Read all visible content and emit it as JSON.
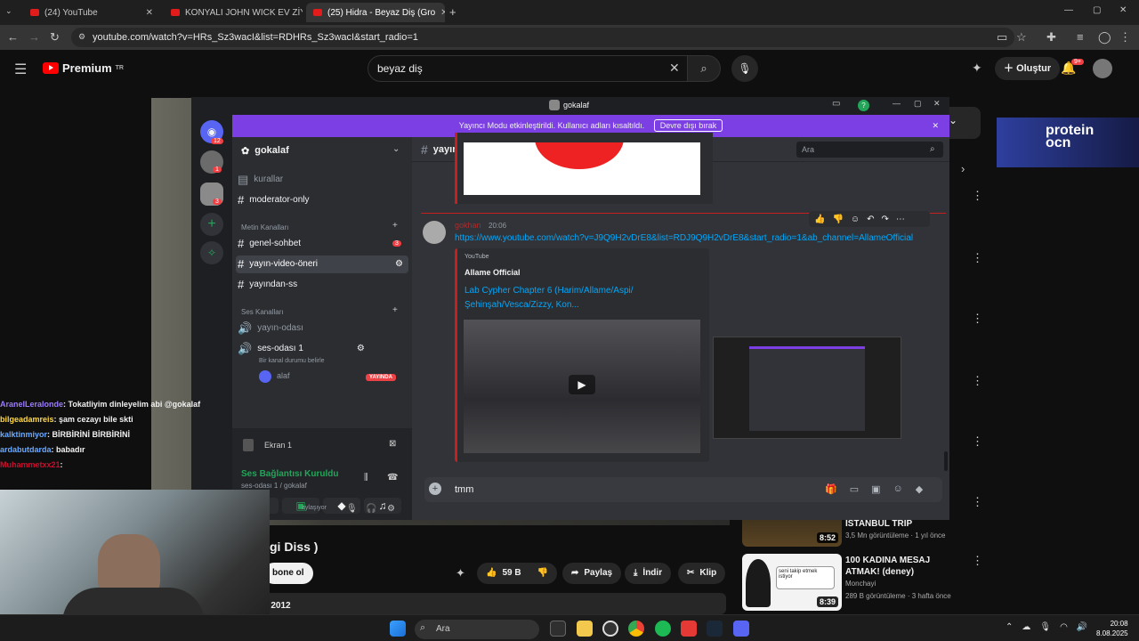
{
  "browser": {
    "tabs": [
      {
        "title": "(24) YouTube"
      },
      {
        "title": "KONYALI JOHN WICK EV ZİYAR"
      },
      {
        "title": "(25) Hidra - Beyaz Diş (Gro"
      }
    ],
    "url": "youtube.com/watch?v=HRs_Sz3wacI&list=RDHRs_Sz3wacI&start_radio=1"
  },
  "youtube": {
    "logo_text": "Premium",
    "logo_sup": "TR",
    "search_value": "beyaz diş",
    "create_label": "Oluştur",
    "notif_badge": "9+",
    "video_title_fragment": "gi Diss )",
    "subscribe_label": "bone ol",
    "like_count": "59 B",
    "share_label": "Paylaş",
    "download_label": "İndir",
    "clip_label": "Klip",
    "year_fragment": "a 2012",
    "ad_text": "protein ocn",
    "recs": [
      {
        "title": "İSTANBUL TRİP",
        "channel": "",
        "meta": "3,5 Mn görüntüleme · 1 yıl önce",
        "duration": "8:52"
      },
      {
        "title": "100 KADINA MESAJ ATMAK! (deney)",
        "channel": "Monchayi",
        "meta": "289 B görüntüleme · 3 hafta önce",
        "duration": "8:39"
      }
    ],
    "rec_thumb_text": "seni takip etmek istiyor"
  },
  "discord": {
    "window_title": "gokalaf",
    "stream_notice": "Yayıncı Modu etkinleştirildi. Kullanıcı adları kısaltıldı.",
    "stream_button": "Devre dışı bırak",
    "server_name": "gokalaf",
    "rail_badges": [
      "12",
      "1",
      "3"
    ],
    "channels_top": [
      {
        "name": "kurallar"
      },
      {
        "name": "moderator-only"
      }
    ],
    "text_category": "Metin Kanalları",
    "text_channels": [
      {
        "name": "genel-sohbet",
        "badge": "3"
      },
      {
        "name": "yayın-video-öneri"
      },
      {
        "name": "yayından-ss"
      }
    ],
    "voice_category": "Ses Kanalları",
    "voice_channels": [
      {
        "name": "yayın-odası"
      },
      {
        "name": "ses-odası 1",
        "status": "Bir kanal durumu belirle"
      }
    ],
    "voice_user": "alaf",
    "live_badge": "YAYINDA",
    "screen_share": "Ekran 1",
    "rtc_status": "Ses Bağlantısı Kuruldu",
    "rtc_channel": "ses-odası 1 / gokalaf",
    "sharing_fragment": "aylaşıyor",
    "current_channel": "yayın-video-öneri",
    "search_placeholder": "Ara",
    "message": {
      "author": "gokhan",
      "time": "20:06",
      "link": "https://www.youtube.com/watch?v=J9Q9H2vDrE8&list=RDJ9Q9H2vDrE8&start_radio=1&ab_channel=AllameOfficial",
      "provider": "YouTube",
      "embed_author": "Allame Official",
      "embed_title": "Lab Cypher Chapter 6 (Harim/Allame/Aspi/ Şehinşah/Vesca/Zizzy, Kon..."
    },
    "input_value": "tmm"
  },
  "twitch_chat": [
    {
      "user": "AranelLeralonde",
      "text": ": Tokatliyim dinleyelim abi @gokalaf",
      "color": "#9b7bff"
    },
    {
      "user": "bilgeadamreis",
      "text": ": şam cezayı bile skti",
      "color": "#ffd84a"
    },
    {
      "user": "kalktinmiyor",
      "text": ": BİRBİRİNİ BİRBİRİNİ",
      "color": "#6aa9ff"
    },
    {
      "user": "ardabutdarda",
      "text": ": babadır",
      "color": "#6aa9ff"
    },
    {
      "user": "Muhammetxx21",
      "text": ":",
      "color": "#c8102e"
    }
  ],
  "taskbar": {
    "search_label": "Ara",
    "time": "20:08",
    "date": "8.08.2025"
  },
  "colors": {
    "discord_accent": "#7b3fe4",
    "youtube_red": "#ff0000",
    "live_red": "#ed4245"
  }
}
